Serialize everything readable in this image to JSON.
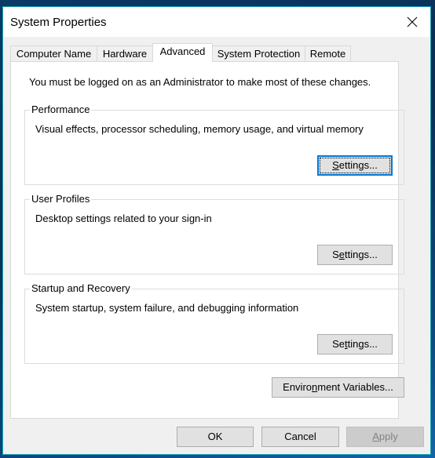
{
  "window": {
    "title": "System Properties",
    "close_icon": "close-icon",
    "accent_border": "#1aa3b8",
    "focus_color": "#0078d7"
  },
  "tabs": [
    {
      "label": "Computer Name",
      "selected": false
    },
    {
      "label": "Hardware",
      "selected": false
    },
    {
      "label": "Advanced",
      "selected": true
    },
    {
      "label": "System Protection",
      "selected": false
    },
    {
      "label": "Remote",
      "selected": false
    }
  ],
  "advanced": {
    "admin_note": "You must be logged on as an Administrator to make most of these changes.",
    "groups": [
      {
        "label": "Performance",
        "description": "Visual effects, processor scheduling, memory usage, and virtual memory",
        "button": {
          "pre": "",
          "accel": "S",
          "post": "ettings...",
          "focused": true
        }
      },
      {
        "label": "User Profiles",
        "description": "Desktop settings related to your sign-in",
        "button": {
          "pre": "S",
          "accel": "e",
          "post": "ttings...",
          "focused": false
        }
      },
      {
        "label": "Startup and Recovery",
        "description": "System startup, system failure, and debugging information",
        "button": {
          "pre": "Se",
          "accel": "t",
          "post": "tings...",
          "focused": false
        }
      }
    ],
    "env_button": {
      "pre": "Enviro",
      "accel": "n",
      "post": "ment Variables..."
    }
  },
  "footer": {
    "ok": "OK",
    "cancel": "Cancel",
    "apply": {
      "pre": "",
      "accel": "A",
      "post": "pply",
      "disabled": true
    }
  }
}
